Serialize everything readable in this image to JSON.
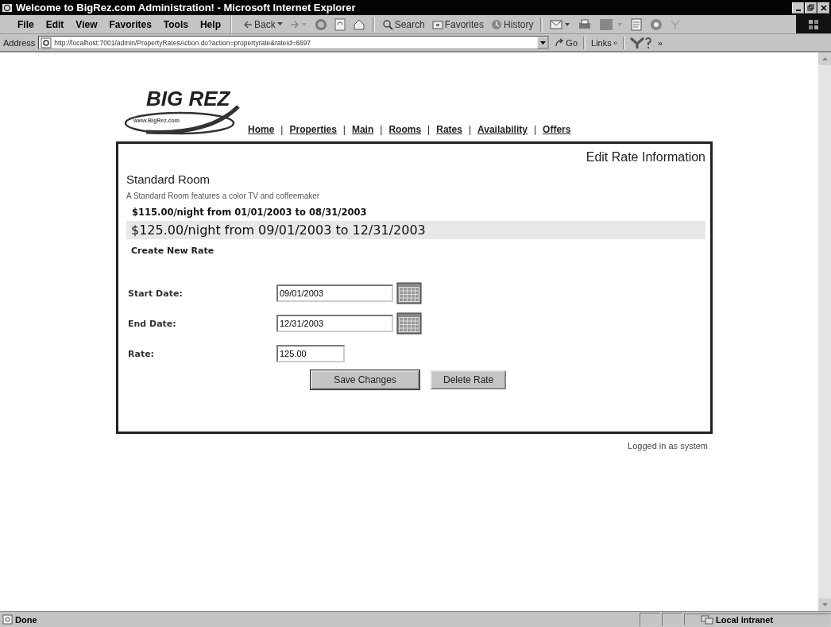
{
  "window": {
    "title": "Welcome to BigRez.com Administration! - Microsoft Internet Explorer"
  },
  "menu": [
    "File",
    "Edit",
    "View",
    "Favorites",
    "Tools",
    "Help"
  ],
  "toolbar": [
    {
      "kind": "back",
      "label": "Back"
    },
    {
      "kind": "search",
      "label": "Search"
    },
    {
      "kind": "favorites",
      "label": "Favorites"
    },
    {
      "kind": "history",
      "label": "History"
    }
  ],
  "address": {
    "label": "Address",
    "value": "http://localhost:7001/admin/PropertyRatesAction.do?action=propertyrate&rateid=6697",
    "go": "Go",
    "links": "Links",
    "links_more": "»",
    "more": "»"
  },
  "logo": {
    "title": "BIG REZ",
    "subtitle": "www.BigRez.com"
  },
  "nav": [
    "Home",
    "Properties",
    "Main",
    "Rooms",
    "Rates",
    "Availability",
    "Offers"
  ],
  "nav_separator": "|",
  "panel": {
    "heading": "Edit Rate Information",
    "room": "Standard Room",
    "description": "A Standard Room features a color TV and coffeemaker",
    "rates": [
      {
        "label": "$115.00/night from 01/01/2003 to 08/31/2003",
        "selected": false
      },
      {
        "label": "$125.00/night from 09/01/2003 to 12/31/2003",
        "selected": true
      }
    ],
    "create_link": "Create New Rate",
    "fields": [
      {
        "label": "Start Date:",
        "value": "09/01/2003",
        "kind": "date"
      },
      {
        "label": "End Date:",
        "value": "12/31/2003",
        "kind": "date"
      },
      {
        "label": "Rate:",
        "value": "125.00",
        "kind": "text"
      }
    ],
    "buttons": [
      "Save Changes",
      "Delete Rate"
    ]
  },
  "logged_in": "Logged in as system",
  "status_bar": {
    "text": "Done",
    "zone": "Local intranet"
  }
}
